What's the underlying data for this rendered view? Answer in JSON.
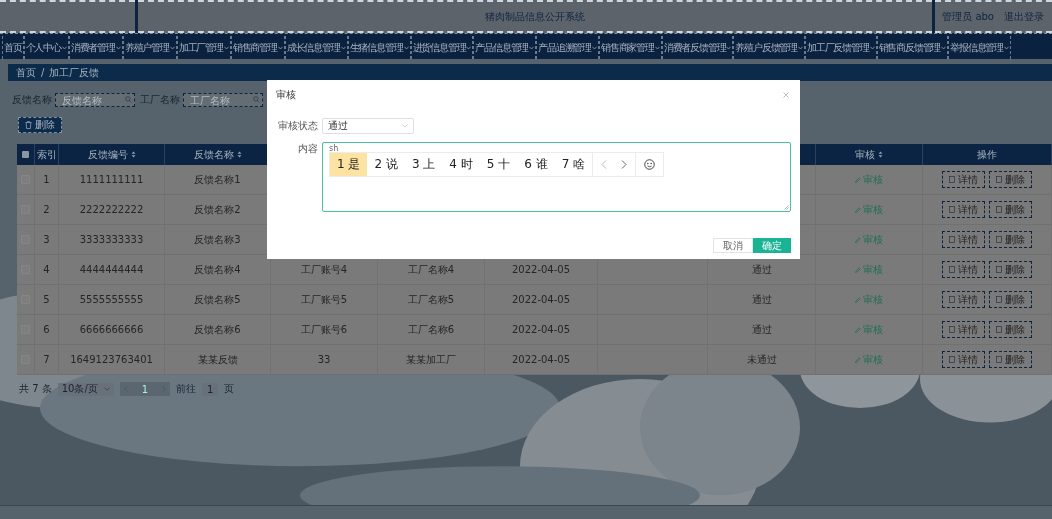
{
  "header": {
    "title": "猪肉制品信息公开系统",
    "user": "管理员 abo",
    "logout": "退出登录"
  },
  "nav": [
    {
      "label": "首页",
      "has_menu": false
    },
    {
      "label": "个人中心",
      "has_menu": true
    },
    {
      "label": "消费者管理",
      "has_menu": true
    },
    {
      "label": "养殖户管理",
      "has_menu": true
    },
    {
      "label": "加工厂管理",
      "has_menu": true
    },
    {
      "label": "销售商管理",
      "has_menu": true
    },
    {
      "label": "成长信息管理",
      "has_menu": true
    },
    {
      "label": "生猪信息管理",
      "has_menu": true
    },
    {
      "label": "进货信息管理",
      "has_menu": true
    },
    {
      "label": "产品信息管理",
      "has_menu": true
    },
    {
      "label": "产品追溯管理",
      "has_menu": true
    },
    {
      "label": "销售商家管理",
      "has_menu": true
    },
    {
      "label": "消费者反馈管理",
      "has_menu": true
    },
    {
      "label": "养殖户反馈管理",
      "has_menu": true
    },
    {
      "label": "加工厂反馈管理",
      "has_menu": true
    },
    {
      "label": "销售商反馈管理",
      "has_menu": true
    },
    {
      "label": "举报信息管理",
      "has_menu": true
    }
  ],
  "breadcrumb": {
    "items": [
      "首页",
      "加工厂反馈"
    ],
    "separator": "/"
  },
  "search": [
    {
      "label": "反馈名称",
      "placeholder": "反馈名称"
    },
    {
      "label": "工厂名称",
      "placeholder": "工厂名称"
    }
  ],
  "delete_button": "删除",
  "table": {
    "select_all_checked": false,
    "columns_left": [
      {
        "label": "索引",
        "sortable": false
      },
      {
        "label": "反馈编号",
        "sortable": true
      },
      {
        "label": "反馈名称",
        "sortable": true
      }
    ],
    "columns_right": [
      {
        "label": "审核",
        "sortable": true
      },
      {
        "label": "操作",
        "sortable": false
      }
    ],
    "rows": [
      {
        "selected": false,
        "index": "1",
        "number": "1111111111",
        "name": "反馈名称1",
        "audit": "审核",
        "actions": [
          "详情",
          "删除"
        ]
      },
      {
        "selected": false,
        "index": "2",
        "number": "2222222222",
        "name": "反馈名称2",
        "audit": "审核",
        "actions": [
          "详情",
          "删除"
        ]
      },
      {
        "selected": false,
        "index": "3",
        "number": "3333333333",
        "name": "反馈名称3",
        "audit": "审核",
        "actions": [
          "详情",
          "删除"
        ]
      },
      {
        "selected": false,
        "index": "4",
        "number": "4444444444",
        "name": "反馈名称4",
        "account": "工厂账号4",
        "factory": "工厂名称4",
        "date": "2022-04-05",
        "status": "通过",
        "audit": "审核",
        "actions": [
          "详情",
          "删除"
        ]
      },
      {
        "selected": false,
        "index": "5",
        "number": "5555555555",
        "name": "反馈名称5",
        "account": "工厂账号5",
        "factory": "工厂名称5",
        "date": "2022-04-05",
        "status": "通过",
        "audit": "审核",
        "actions": [
          "详情",
          "删除"
        ]
      },
      {
        "selected": false,
        "index": "6",
        "number": "6666666666",
        "name": "反馈名称6",
        "account": "工厂账号6",
        "factory": "工厂名称6",
        "date": "2022-04-05",
        "status": "通过",
        "audit": "审核",
        "actions": [
          "详情",
          "删除"
        ]
      },
      {
        "selected": false,
        "index": "7",
        "number": "1649123763401",
        "name": "某某反馈",
        "account": "33",
        "factory": "某某加工厂",
        "date": "2022-04-05",
        "status": "未通过",
        "audit": "审核",
        "actions": [
          "详情",
          "删除"
        ]
      }
    ]
  },
  "pagination": {
    "total": "共 7 条",
    "page_size": "10条/页",
    "current_page": "1",
    "goto_label": "前往",
    "goto_value": "1",
    "goto_unit": "页"
  },
  "dialog": {
    "title": "审核",
    "status_label": "审核状态",
    "status_value": "通过",
    "content_label": "内容",
    "composition": "sh",
    "candidates": [
      {
        "number": "1",
        "text": "是",
        "selected": true
      },
      {
        "number": "2",
        "text": "说",
        "selected": false
      },
      {
        "number": "3",
        "text": "上",
        "selected": false
      },
      {
        "number": "4",
        "text": "时",
        "selected": false
      },
      {
        "number": "5",
        "text": "十",
        "selected": false
      },
      {
        "number": "6",
        "text": "谁",
        "selected": false
      },
      {
        "number": "7",
        "text": "啥",
        "selected": false
      }
    ],
    "cancel": "取消",
    "confirm": "确定"
  }
}
